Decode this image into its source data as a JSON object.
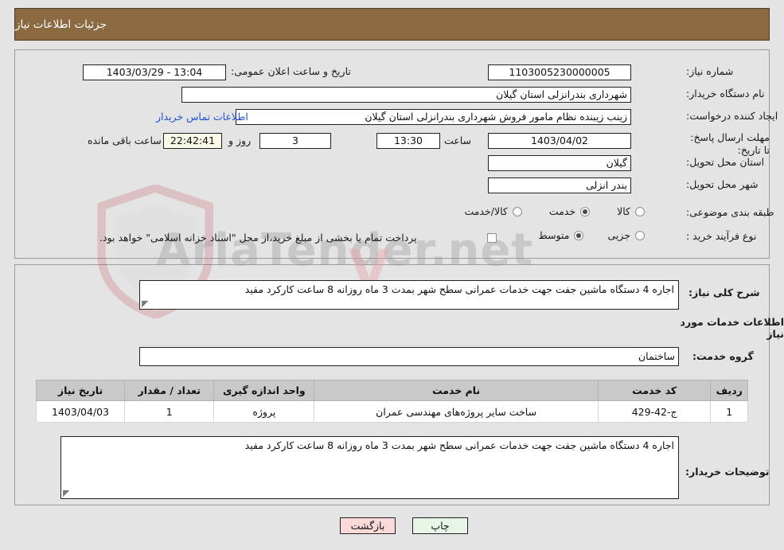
{
  "header": {
    "title": "جزئیات اطلاعات نیاز"
  },
  "top_panel": {
    "need_number": {
      "label": "شماره نیاز:",
      "value": "1103005230000005"
    },
    "announce_datetime": {
      "label": "تاریخ و ساعت اعلان عمومی:",
      "value": "13:04 - 1403/03/29"
    },
    "buyer_org": {
      "label": "نام دستگاه خریدار:",
      "value": "شهرداری بندرانزلی استان گیلان"
    },
    "request_creator": {
      "label": "ایجاد کننده درخواست:",
      "value": "زینب زیبنده نظام مامور فروش شهرداری بندرانزلی استان گیلان"
    },
    "contact_link": "اطلاعات تماس خریدار",
    "deadline": {
      "label": "مهلت ارسال پاسخ: تا تاریخ:",
      "date": "1403/04/02",
      "time_label": "ساعت",
      "time": "13:30",
      "days": "3",
      "days_label": "روز و",
      "timer": "22:42:41",
      "timer_label": "ساعت باقی مانده"
    },
    "delivery_province": {
      "label": "استان محل تحویل:",
      "value": "گیلان"
    },
    "delivery_city": {
      "label": "شهر محل تحویل:",
      "value": "بندر انزلی"
    },
    "subject_category": {
      "label": "طبقه بندی موضوعی:",
      "options": [
        {
          "label": "کالا",
          "selected": false
        },
        {
          "label": "خدمت",
          "selected": true
        },
        {
          "label": "کالا/خدمت",
          "selected": false
        }
      ]
    },
    "purchase_type": {
      "label": "نوع فرآیند خرید :",
      "options": [
        {
          "label": "جزیی",
          "selected": false
        },
        {
          "label": "متوسط",
          "selected": true
        }
      ],
      "treasury_checkbox": {
        "checked": false,
        "text": "پرداخت تمام یا بخشی از مبلغ خرید،از محل \"اسناد خزانه اسلامی\" خواهد بود."
      }
    }
  },
  "bottom_panel": {
    "general_description": {
      "label": "شرح کلی نیاز:",
      "value": "اجاره 4 دستگاه ماشین جفت جهت خدمات عمرانی سطح شهر بمدت 3 ماه روزانه 8 ساعت کارکرد مفید"
    },
    "services_section_title": "اطلاعات خدمات مورد نیاز",
    "service_group": {
      "label": "گروه خدمت:",
      "value": "ساختمان"
    },
    "table": {
      "headers": [
        "ردیف",
        "کد خدمت",
        "نام خدمت",
        "واحد اندازه گیری",
        "تعداد / مقدار",
        "تاریخ نیاز"
      ],
      "rows": [
        {
          "radif": "1",
          "service_code": "ج-42-429",
          "service_name": "ساخت سایر پروژه‌های مهندسی عمران",
          "unit": "پروژه",
          "quantity": "1",
          "need_date": "1403/04/03"
        }
      ]
    },
    "buyer_notes": {
      "label": "توضیحات خریدار:",
      "value": "اجاره 4 دستگاه ماشین جفت جهت خدمات عمرانی سطح شهر بمدت 3 ماه روزانه 8 ساعت کارکرد مفید"
    }
  },
  "footer": {
    "print_label": "چاپ",
    "back_label": "بازگشت"
  },
  "watermark": {
    "text": "AriaTender.net",
    "letter": "V"
  },
  "colors": {
    "header_bg": "#8b6a42",
    "page_bg": "#e4e4e4",
    "link": "#1f4fd8",
    "timer_bg": "#fbf9e7",
    "print_bg": "#e7f6e7",
    "back_bg": "#fbd9d9",
    "table_header_bg": "#c9c9c9"
  }
}
